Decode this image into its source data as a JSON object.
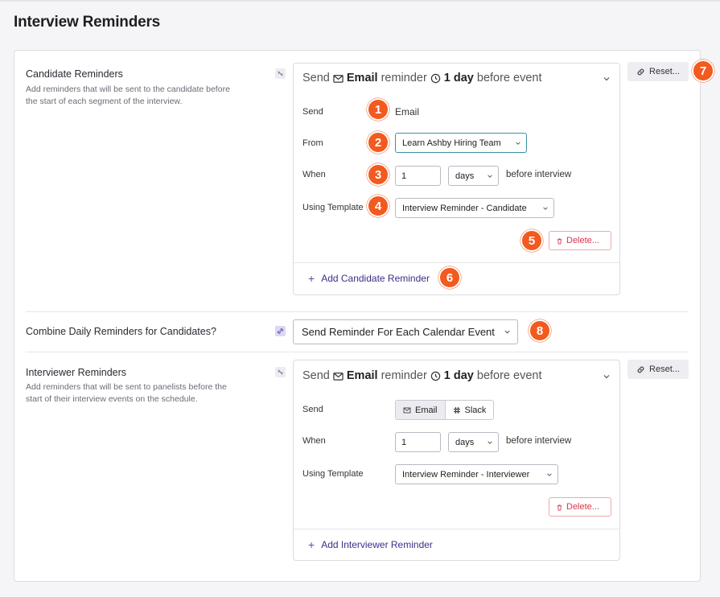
{
  "page_title": "Interview Reminders",
  "candidate": {
    "title": "Candidate Reminders",
    "description": "Add reminders that will be sent to the candidate before the start of each segment of the interview.",
    "card_head": {
      "send": "Send",
      "channel": "Email",
      "reminder": "reminder",
      "time": "1 day",
      "suffix": "before event"
    },
    "send_label": "Send",
    "send_value": "Email",
    "from_label": "From",
    "from_value": "Learn Ashby Hiring Team",
    "when_label": "When",
    "when_number": "1",
    "when_unit": "days",
    "when_suffix": "before interview",
    "template_label": "Using Template",
    "template_value": "Interview Reminder - Candidate",
    "delete_label": "Delete...",
    "add_label": "Add Candidate Reminder",
    "reset_label": "Reset..."
  },
  "combine": {
    "label": "Combine Daily Reminders for Candidates?",
    "value": "Send Reminder For Each Calendar Event"
  },
  "interviewer": {
    "title": "Interviewer Reminders",
    "description": "Add reminders that will be sent to panelists before the start of their interview events on the schedule.",
    "card_head": {
      "send": "Send",
      "channel": "Email",
      "reminder": "reminder",
      "time": "1 day",
      "suffix": "before event"
    },
    "send_label": "Send",
    "send_options": [
      "Email",
      "Slack"
    ],
    "when_label": "When",
    "when_number": "1",
    "when_unit": "days",
    "when_suffix": "before interview",
    "template_label": "Using Template",
    "template_value": "Interview Reminder - Interviewer",
    "delete_label": "Delete...",
    "add_label": "Add Interviewer Reminder",
    "reset_label": "Reset..."
  },
  "badges": [
    "1",
    "2",
    "3",
    "4",
    "5",
    "6",
    "7",
    "8"
  ],
  "colors": {
    "badge": "#f25a1f",
    "link": "#3d2e88",
    "danger": "#d9374b",
    "focus": "#3b8fa8"
  }
}
